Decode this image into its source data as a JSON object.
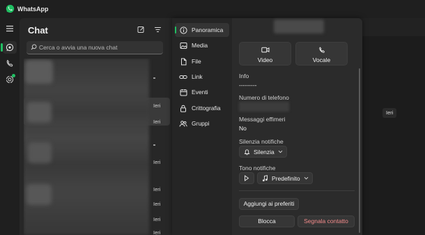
{
  "app": {
    "title": "WhatsApp",
    "accent": "#21c063"
  },
  "rail": {
    "items": [
      {
        "name": "menu-icon"
      },
      {
        "name": "chats-icon"
      },
      {
        "name": "calls-icon"
      },
      {
        "name": "status-icon"
      }
    ]
  },
  "chat_list": {
    "title": "Chat",
    "search_placeholder": "Cerca o avvia una nuova chat",
    "timestamps": [
      "Ieri",
      "Ieri",
      "Ieri",
      "Ieri",
      "Ieri",
      "Ieri",
      "Ieri"
    ]
  },
  "conversation": {
    "time_chip": "Ieri"
  },
  "info_nav": {
    "items": [
      {
        "label": "Panoramica",
        "icon": "info-icon"
      },
      {
        "label": "Media",
        "icon": "media-icon"
      },
      {
        "label": "File",
        "icon": "file-icon"
      },
      {
        "label": "Link",
        "icon": "link-icon"
      },
      {
        "label": "Eventi",
        "icon": "calendar-icon"
      },
      {
        "label": "Crittografia",
        "icon": "lock-icon"
      },
      {
        "label": "Gruppi",
        "icon": "groups-icon"
      }
    ]
  },
  "overview": {
    "video_label": "Video",
    "voice_label": "Vocale",
    "info_label": "Info",
    "info_value": "---------",
    "phone_label": "Numero di telefono",
    "ephemeral_label": "Messaggi effimeri",
    "ephemeral_value": "No",
    "mute_label": "Silenzia notifiche",
    "mute_button": "Silenzia",
    "tone_label": "Tono notifiche",
    "tone_value": "Predefinito",
    "favorites_button": "Aggiungi ai preferiti",
    "block_button": "Blocca",
    "report_button": "Segnala contatto"
  }
}
